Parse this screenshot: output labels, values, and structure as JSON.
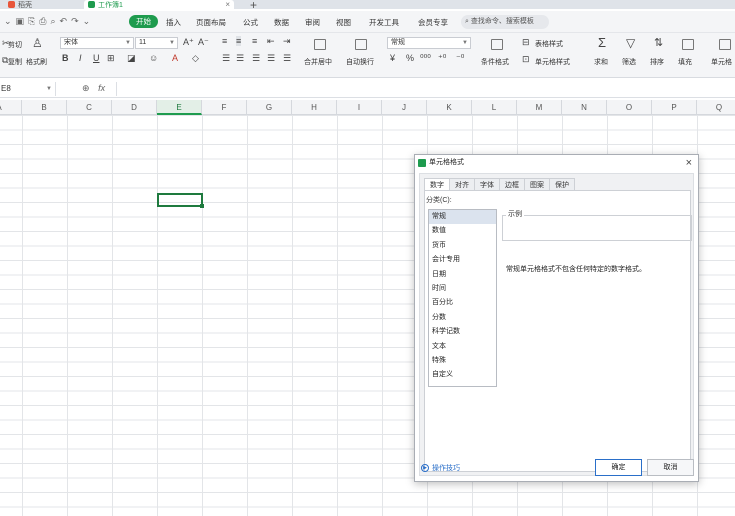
{
  "tabs": [
    {
      "label": "稻壳"
    },
    {
      "label": "工作簿1"
    }
  ],
  "menu": {
    "start": "开始",
    "items": [
      "插入",
      "页面布局",
      "公式",
      "数据",
      "审阅",
      "视图",
      "开发工具",
      "会员专享"
    ],
    "search": "查找命令、搜索模板"
  },
  "ribbon": {
    "cut": "剪切",
    "copy": "复制",
    "format_painter": "格式刷",
    "font_name": "宋体",
    "font_size": "11",
    "merge_center": "合并居中",
    "wrap_text": "自动换行",
    "number_format": "常规",
    "conditional_format": "条件格式",
    "table_style": "表格样式",
    "cell_style": "单元格样式",
    "sum": "求和",
    "filter": "筛选",
    "sort": "排序",
    "fill": "填充",
    "cell": "单元格"
  },
  "formula_bar": {
    "name_box": "E8",
    "fx": "fx"
  },
  "columns": [
    "A",
    "B",
    "C",
    "D",
    "E",
    "F",
    "G",
    "H",
    "I",
    "J",
    "K",
    "L",
    "M",
    "N",
    "O",
    "P",
    "Q"
  ],
  "active_column": "E",
  "dialog": {
    "title": "单元格格式",
    "tabs": [
      "数字",
      "对齐",
      "字体",
      "边框",
      "图案",
      "保护"
    ],
    "active_tab": "数字",
    "category_label": "分类(C):",
    "categories": [
      "常规",
      "数值",
      "货币",
      "会计专用",
      "日期",
      "时间",
      "百分比",
      "分数",
      "科学记数",
      "文本",
      "特殊",
      "自定义"
    ],
    "selected_category": "常规",
    "sample_label": "示例",
    "description": "常规单元格格式不包含任何特定的数字格式。",
    "tips": "操作技巧",
    "ok": "确定",
    "cancel": "取消"
  },
  "colors": {
    "accent": "#1e9b4e",
    "link": "#2a6fc9"
  }
}
